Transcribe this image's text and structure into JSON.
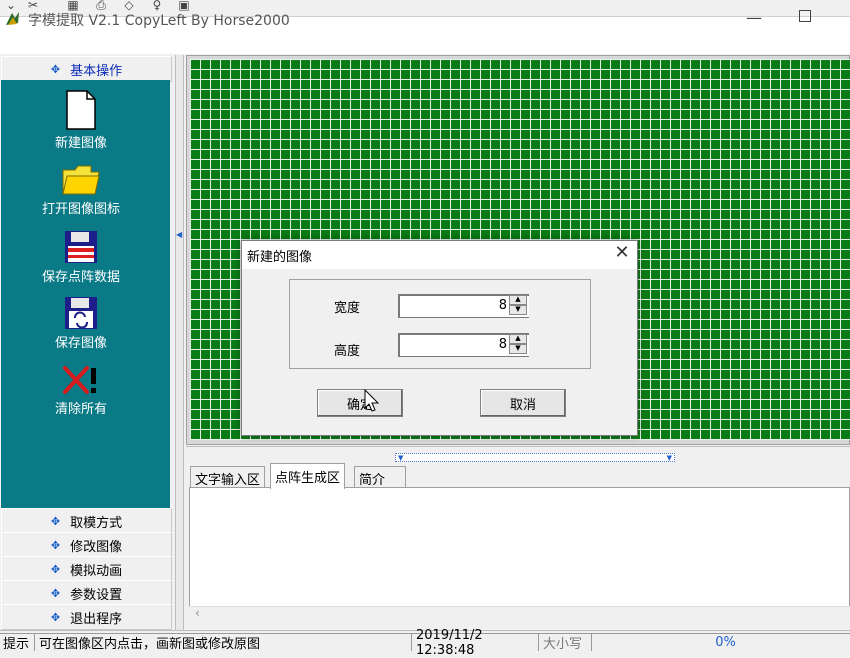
{
  "window": {
    "title": "字模提取 V2.1   CopyLeft By Horse2000",
    "minimize": "—"
  },
  "sidebar": {
    "sections": [
      {
        "label": "基本操作"
      },
      {
        "label": "取模方式"
      },
      {
        "label": "修改图像"
      },
      {
        "label": "模拟动画"
      },
      {
        "label": "参数设置"
      },
      {
        "label": "退出程序"
      }
    ],
    "tools": [
      {
        "label": "新建图像",
        "icon": "new-file-icon"
      },
      {
        "label": "打开图像图标",
        "icon": "folder-icon"
      },
      {
        "label": "保存点阵数据",
        "icon": "floppy-red-icon"
      },
      {
        "label": "保存图像",
        "icon": "floppy-blue-icon"
      },
      {
        "label": "清除所有",
        "icon": "clear-x-icon"
      }
    ]
  },
  "tabs": [
    {
      "label": "文字输入区"
    },
    {
      "label": "点阵生成区"
    },
    {
      "label": "简介"
    }
  ],
  "status": {
    "hint_label": "提示",
    "hint_text": "可在图像区内点击，画新图或修改原图",
    "datetime": "2019/11/2 12:38:48",
    "caps": "大小写",
    "progress": "0%"
  },
  "dialog": {
    "title": "新建的图像",
    "close": "✕",
    "width_label": "宽度",
    "width_value": "8",
    "height_label": "高度",
    "height_value": "8",
    "ok": "确定",
    "cancel": "取消"
  },
  "colors": {
    "panel": "#0b7a87",
    "grid": "#0a7c16",
    "accent": "#0b2bb5"
  }
}
